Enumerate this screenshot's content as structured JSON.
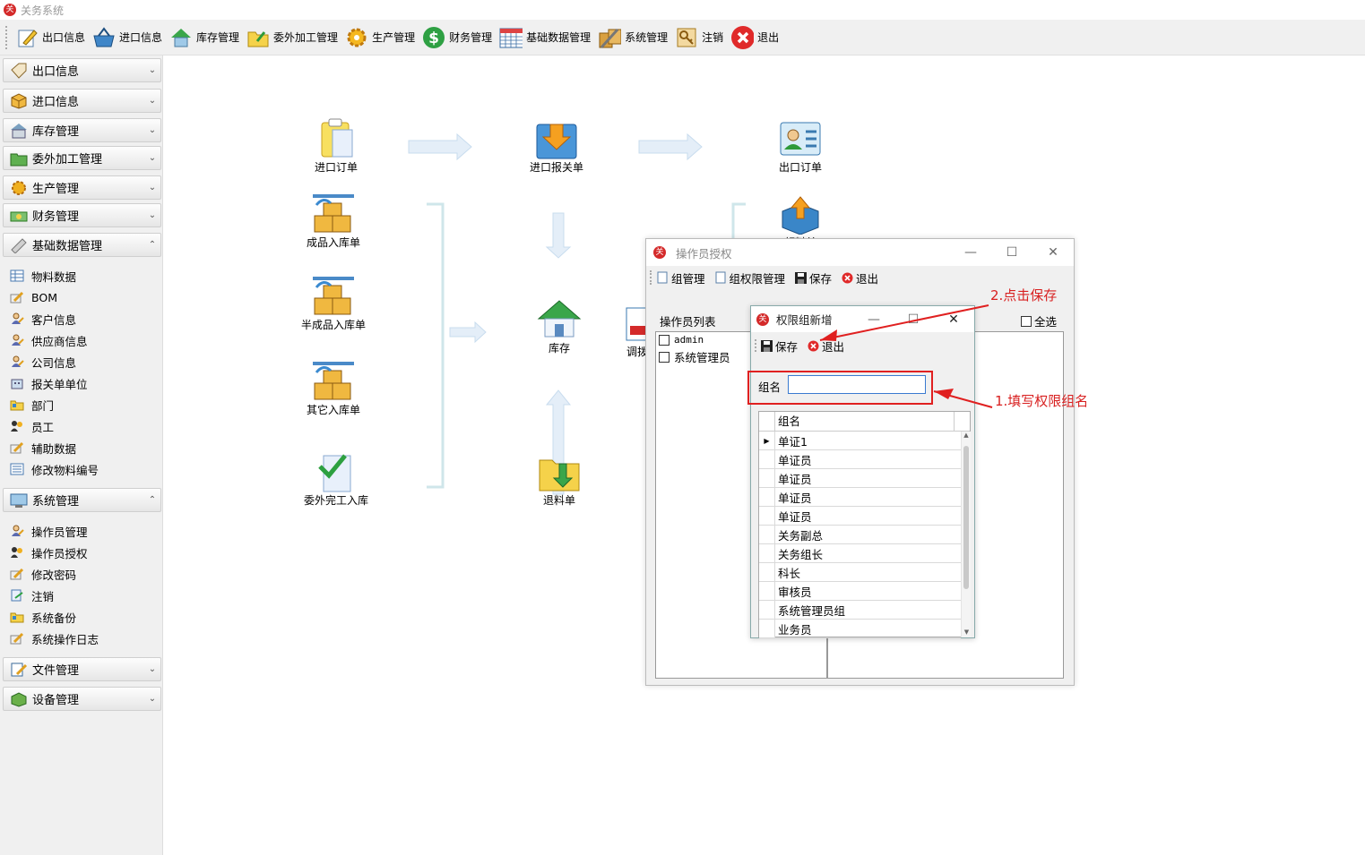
{
  "app": {
    "title": "关务系统",
    "logo": "关"
  },
  "toolbar": [
    {
      "label": "出口信息",
      "icon": "edit-icon"
    },
    {
      "label": "进口信息",
      "icon": "basket-icon"
    },
    {
      "label": "库存管理",
      "icon": "house-icon"
    },
    {
      "label": "委外加工管理",
      "icon": "folder-icon"
    },
    {
      "label": "生产管理",
      "icon": "gear-icon"
    },
    {
      "label": "财务管理",
      "icon": "dollar-icon"
    },
    {
      "label": "基础数据管理",
      "icon": "calendar-icon"
    },
    {
      "label": "系统管理",
      "icon": "tools-icon"
    },
    {
      "label": "注销",
      "icon": "key-icon"
    },
    {
      "label": "退出",
      "icon": "close-icon"
    }
  ],
  "sidebar": {
    "sections": [
      {
        "label": "出口信息",
        "state": "collapsed"
      },
      {
        "label": "进口信息",
        "state": "collapsed"
      },
      {
        "label": "库存管理",
        "state": "collapsed"
      },
      {
        "label": "委外加工管理",
        "state": "collapsed"
      },
      {
        "label": "生产管理",
        "state": "collapsed"
      },
      {
        "label": "财务管理",
        "state": "collapsed"
      },
      {
        "label": "基础数据管理",
        "state": "expanded"
      },
      {
        "label": "系统管理",
        "state": "expanded"
      },
      {
        "label": "文件管理",
        "state": "collapsed"
      },
      {
        "label": "设备管理",
        "state": "collapsed"
      }
    ],
    "basic_items": [
      "物料数据",
      "BOM",
      "客户信息",
      "供应商信息",
      "公司信息",
      "报关单单位",
      "部门",
      "员工",
      "辅助数据",
      "修改物料编号"
    ],
    "system_items": [
      "操作员管理",
      "操作员授权",
      "修改密码",
      "注销",
      "系统备份",
      "系统操作日志"
    ]
  },
  "flow": {
    "import_order": "进口订单",
    "import_declaration": "进口报关单",
    "export_order": "出口订单",
    "product_in": "成品入库单",
    "semi_in": "半成品入库单",
    "other_in": "其它入库单",
    "outsource_in": "委外完工入库",
    "stock": "库存",
    "return": "退料单",
    "pick": "领料单",
    "transfer": "调拨"
  },
  "dialog_auth": {
    "title": "操作员授权",
    "toolbar": [
      "组管理",
      "组权限管理",
      "保存",
      "退出"
    ],
    "list_label": "操作员列表",
    "operators": [
      "admin",
      "系统管理员"
    ],
    "select_all": "全选"
  },
  "dialog_group": {
    "title": "权限组新增",
    "save": "保存",
    "exit": "退出",
    "name_label": "组名",
    "name_value": "",
    "grid_header": "组名",
    "rows": [
      "单证1",
      "单证员",
      "单证员",
      "单证员",
      "单证员",
      "关务副总",
      "关务组长",
      "科长",
      "审核员",
      "系统管理员组",
      "业务员"
    ]
  },
  "annotations": {
    "step1": "1.填写权限组名",
    "step2": "2.点击保存"
  },
  "colors": {
    "accent_red": "#d82020",
    "logo_red": "#d42a2a"
  }
}
